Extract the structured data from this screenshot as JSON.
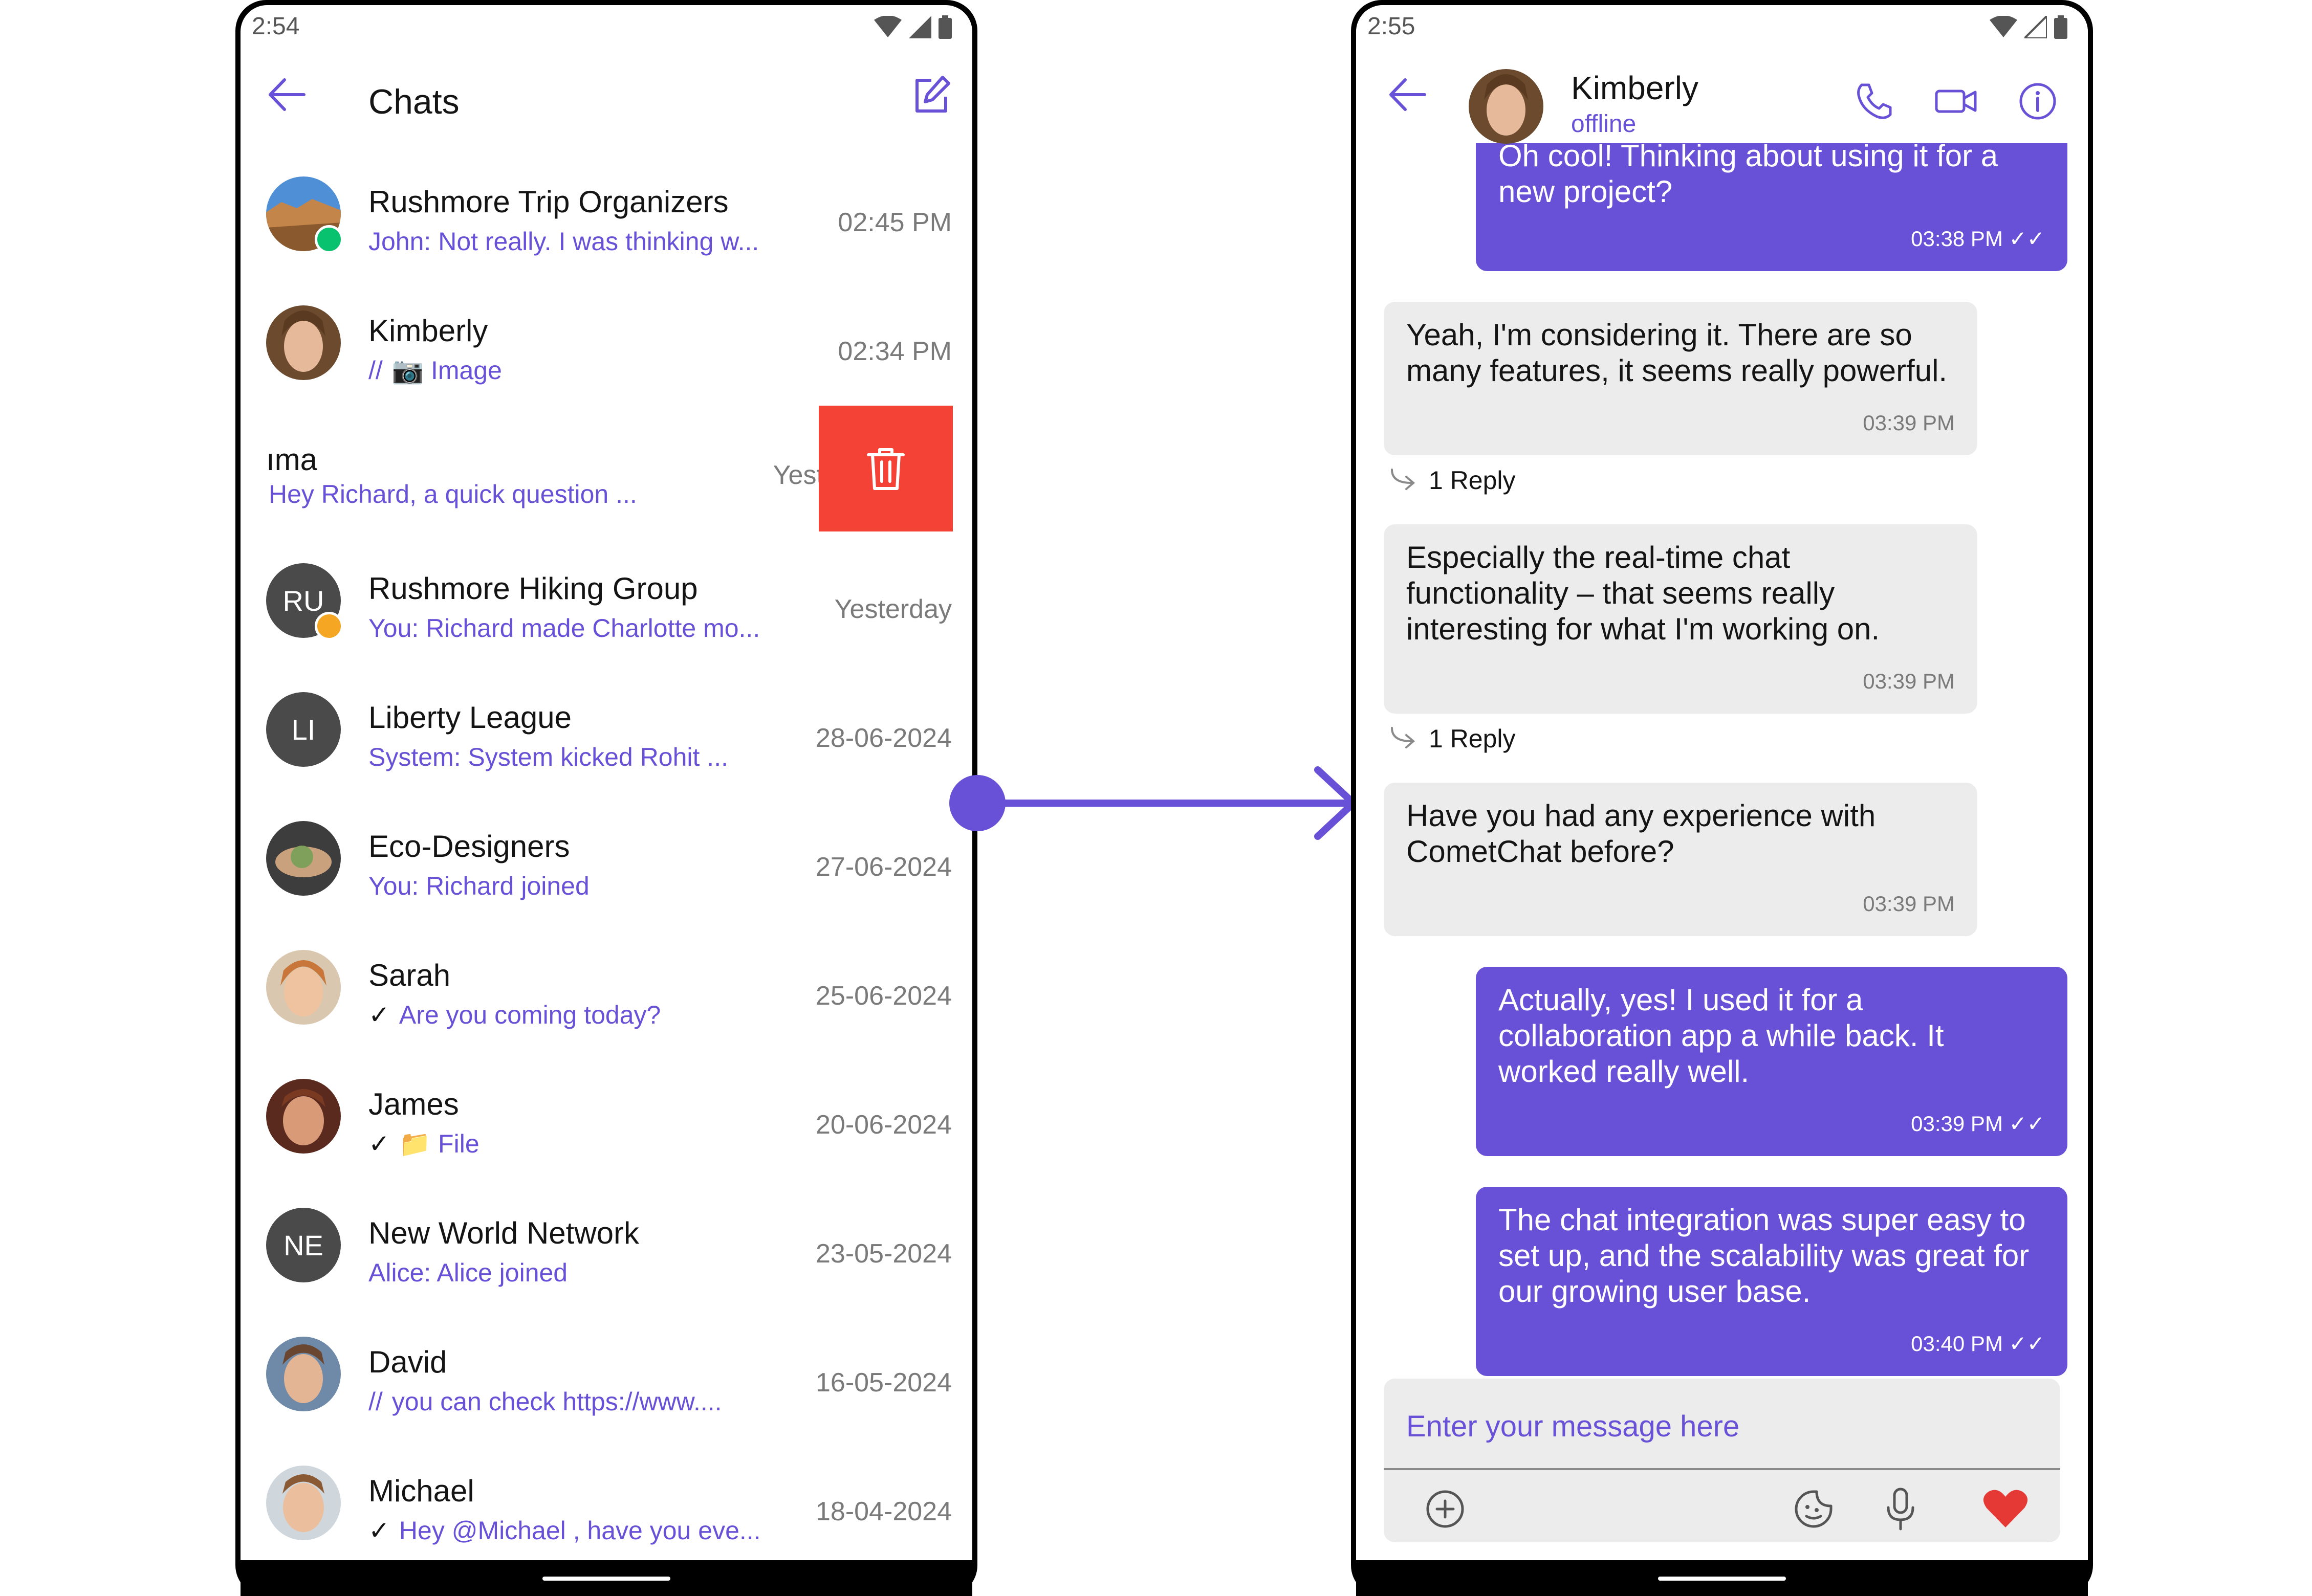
{
  "left_phone": {
    "status_time": "2:54",
    "header": {
      "title": "Chats"
    },
    "conversations": [
      {
        "name": "Rushmore Trip Organizers",
        "preview": "John: Not really.  I was thinking w...",
        "time": "02:45 PM"
      },
      {
        "name": "Kimberly",
        "receipt": "//",
        "preview": "📷 Image",
        "time": "02:34 PM"
      },
      {
        "name": "ıma",
        "preview": "Hey Richard, a quick question ...",
        "time": "Yesterday"
      },
      {
        "name": "Rushmore Hiking Group",
        "initials": "RU",
        "preview": "You: Richard made Charlotte mo...",
        "time": "Yesterday"
      },
      {
        "name": "Liberty League",
        "initials": "LI",
        "preview": "System: System kicked Rohit ...",
        "time": "28-06-2024"
      },
      {
        "name": "Eco-Designers",
        "preview": "You: Richard joined",
        "time": "27-06-2024"
      },
      {
        "name": "Sarah",
        "receipt": "✓",
        "preview": "Are you coming today?",
        "time": "25-06-2024"
      },
      {
        "name": "James",
        "receipt": "✓",
        "preview": "📁 File",
        "time": "20-06-2024"
      },
      {
        "name": "New World Network",
        "initials": "NE",
        "preview": "Alice: Alice joined",
        "time": "23-05-2024"
      },
      {
        "name": "David",
        "receipt": "//",
        "preview": "you can check https://www....",
        "time": "16-05-2024"
      },
      {
        "name": "Michael",
        "receipt": "✓",
        "preview": "Hey @Michael , have you eve...",
        "time": "18-04-2024"
      }
    ],
    "delete_action_color": "#F44336"
  },
  "right_phone": {
    "status_time": "2:55",
    "header": {
      "name": "Kimberly",
      "status": "offline"
    },
    "messages": [
      {
        "direction": "out",
        "text": "Oh cool! Thinking about using it for a new project?",
        "time": "03:38 PM"
      },
      {
        "direction": "in",
        "text": "Yeah, I'm considering it.  There are so many features, it seems really powerful.",
        "time": "03:39 PM",
        "replies": "1 Reply"
      },
      {
        "direction": "in",
        "text": "Especially the real-time chat functionality – that seems really interesting for what I'm working on.",
        "time": "03:39 PM",
        "replies": "1 Reply"
      },
      {
        "direction": "in",
        "text": "Have you had any experience with CometChat before?",
        "time": "03:39 PM"
      },
      {
        "direction": "out",
        "text": "Actually, yes!  I used it for a collaboration app a while back.  It worked really well.",
        "time": "03:39 PM"
      },
      {
        "direction": "out",
        "text": "The chat integration was super easy to set up, and the scalability was great for our growing user base.",
        "time": "03:40 PM"
      }
    ],
    "composer": {
      "placeholder": "Enter your message here"
    }
  },
  "colors": {
    "accent": "#6851D6",
    "incoming_bubble": "#ECECEC",
    "delete": "#F44336",
    "heart": "#E53935"
  }
}
